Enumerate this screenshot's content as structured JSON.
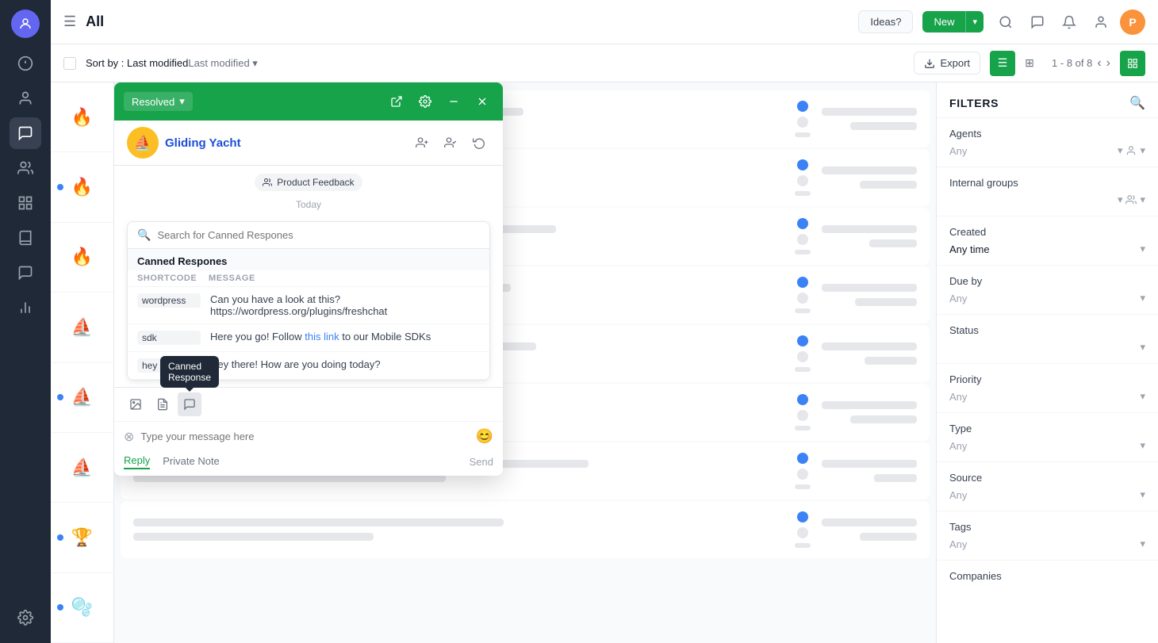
{
  "topnav": {
    "menu_icon": "☰",
    "title": "All",
    "ideas_label": "Ideas?",
    "new_label": "New",
    "chevron": "▾",
    "user_initial": "P"
  },
  "toolbar": {
    "sort_label": "Sort by :",
    "sort_value": "Last modified",
    "export_label": "Export",
    "pagination": "1 - 8 of 8",
    "prev_icon": "‹",
    "next_icon": "›"
  },
  "chat": {
    "resolved_label": "Resolved",
    "contact_name": "Gliding Yacht",
    "product_tag": "Product Feedback",
    "today_label": "Today",
    "search_placeholder": "Search for Canned Respones",
    "canned_title": "Canned Respones",
    "col_shortcode": "SHORTCODE",
    "col_message": "MESSAGE",
    "rows": [
      {
        "code": "wordpress",
        "message": "Can you have a look at this? https://wordpress.org/plugins/freshchat"
      },
      {
        "code": "sdk",
        "message_prefix": "Here you go! Follow ",
        "link_text": "this link",
        "message_suffix": " to our Mobile SDKs"
      },
      {
        "code": "hey",
        "message": "Hey there! How are you doing today?"
      }
    ],
    "input_placeholder": "Type your message here",
    "tab_reply": "Reply",
    "tab_private": "Private Note",
    "send_label": "Send",
    "canned_tooltip_line1": "Canned",
    "canned_tooltip_line2": "Response"
  },
  "filters": {
    "title": "FILTERS",
    "agents_label": "Agents",
    "agents_value": "Any",
    "internal_groups_label": "Internal groups",
    "created_label": "Created",
    "created_value": "Any time",
    "due_by_label": "Due by",
    "due_by_value": "Any",
    "status_label": "Status",
    "priority_label": "Priority",
    "priority_value": "Any",
    "type_label": "Type",
    "type_value": "Any",
    "source_label": "Source",
    "source_value": "Any",
    "tags_label": "Tags",
    "tags_value": "Any",
    "companies_label": "Companies"
  },
  "conversations": [
    {
      "avatar": "🔥",
      "dot": false
    },
    {
      "avatar": "🔥",
      "dot": true
    },
    {
      "avatar": "🔥",
      "dot": false
    },
    {
      "avatar": "⛵",
      "dot": false
    },
    {
      "avatar": "⛵",
      "dot": true
    },
    {
      "avatar": "⛵",
      "dot": false
    },
    {
      "avatar": "🏆",
      "dot": true
    },
    {
      "avatar": "🫧",
      "dot": true
    }
  ]
}
